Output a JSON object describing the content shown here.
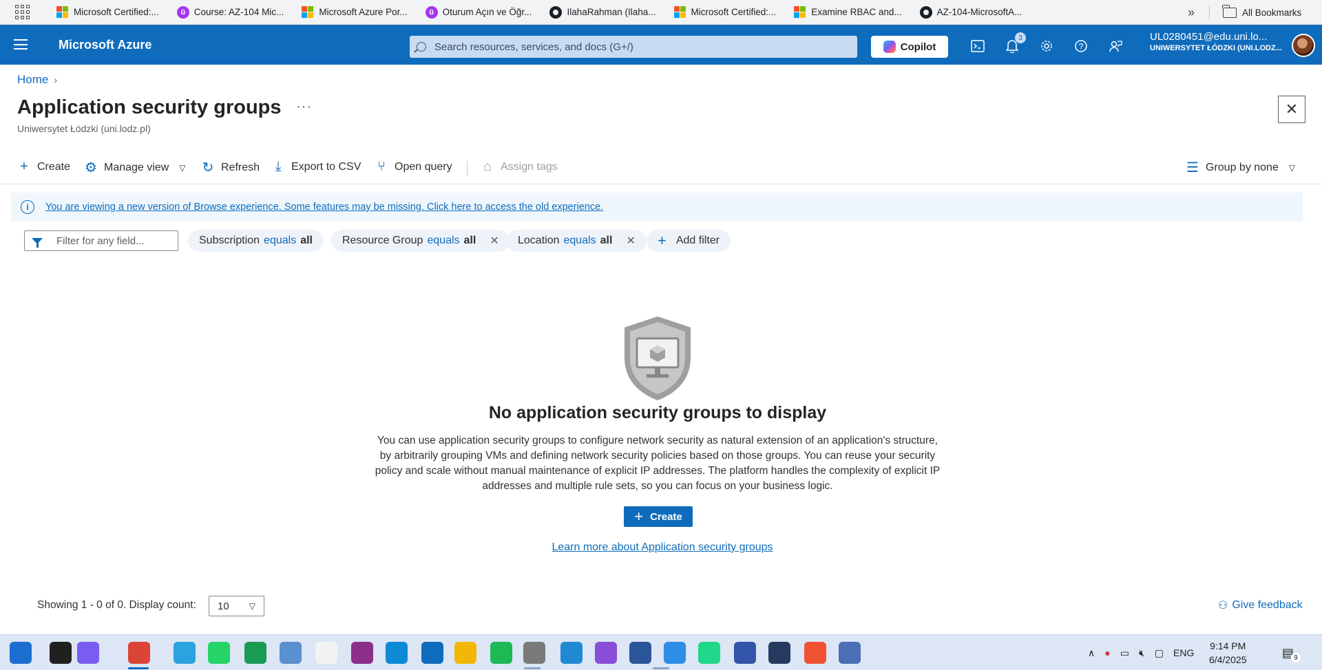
{
  "bookmarks": {
    "items": [
      {
        "label": "Microsoft Certified:...",
        "icon": "microsoft-logo"
      },
      {
        "label": "Course: AZ-104 Mic...",
        "icon": "udemy-logo"
      },
      {
        "label": "Microsoft Azure Por...",
        "icon": "microsoft-logo"
      },
      {
        "label": "Oturum Açın ve Öğr...",
        "icon": "udemy-logo"
      },
      {
        "label": "IlahaRahman (Ilaha...",
        "icon": "github-logo"
      },
      {
        "label": "Microsoft Certified:...",
        "icon": "microsoft-logo"
      },
      {
        "label": "Examine RBAC and...",
        "icon": "microsoft-logo"
      },
      {
        "label": "AZ-104-MicrosoftA...",
        "icon": "github-logo"
      }
    ],
    "udemy_letter": "ū",
    "more": "»",
    "all_bookmarks": "All Bookmarks"
  },
  "topnav": {
    "brand": "Microsoft Azure",
    "search_placeholder": "Search resources, services, and docs (G+/)",
    "copilot_label": "Copilot",
    "notifications_count": "3",
    "user_email": "UL0280451@edu.uni.lo...",
    "user_org": "UNIWERSYTET ŁÓDZKI (UNI.LODZ..."
  },
  "breadcrumb": {
    "home": "Home"
  },
  "page": {
    "title": "Application security groups",
    "subtitle": "Uniwersytet Łódzki (uni.lodz.pl)",
    "more": "···"
  },
  "commands": {
    "create": "Create",
    "manage_view": "Manage view",
    "refresh": "Refresh",
    "export_csv": "Export to CSV",
    "open_query": "Open query",
    "assign_tags": "Assign tags",
    "group_by": "Group by none"
  },
  "banner": {
    "text": "You are viewing a new version of Browse experience. Some features may be missing. Click here to access the old experience."
  },
  "filters": {
    "placeholder": "Filter for any field...",
    "pills": [
      {
        "field": "Subscription",
        "op": "equals",
        "value": "all",
        "removable": false
      },
      {
        "field": "Resource Group",
        "op": "equals",
        "value": "all",
        "removable": true
      },
      {
        "field": "Location",
        "op": "equals",
        "value": "all",
        "removable": true
      }
    ],
    "add_filter": "Add filter"
  },
  "empty_state": {
    "title": "No application security groups to display",
    "description": "You can use application security groups to configure network security as natural extension of an application's structure, by arbitrarily grouping VMs and defining network security policies based on those groups. You can reuse your security policy and scale without manual maintenance of explicit IP addresses. The platform handles the complexity of explicit IP addresses and multiple rule sets, so you can focus on your business logic.",
    "create_label": "Create",
    "learn_more": "Learn more about Application security groups"
  },
  "footer": {
    "showing": "Showing 1 - 0 of 0. Display count:",
    "display_count": "10",
    "feedback": "Give feedback"
  },
  "taskbar": {
    "language": "ENG",
    "time": "9:14 PM",
    "date": "6/4/2025",
    "notification_count": "9",
    "apps": [
      {
        "name": "start",
        "color": "#1c6fd1"
      },
      {
        "name": "search",
        "color": "#202020"
      },
      {
        "name": "copilot",
        "color": "#7b5cf0"
      },
      {
        "name": "chrome",
        "color": "#db4437"
      },
      {
        "name": "telegram",
        "color": "#2aa3df"
      },
      {
        "name": "whatsapp",
        "color": "#25d366"
      },
      {
        "name": "clion",
        "color": "#1a9b54"
      },
      {
        "name": "contacts",
        "color": "#5a8fd0"
      },
      {
        "name": "notepad",
        "color": "#f2f2f2"
      },
      {
        "name": "winrar",
        "color": "#8b2f8b"
      },
      {
        "name": "edge",
        "color": "#0c8ad6"
      },
      {
        "name": "outlook",
        "color": "#0f6cbd"
      },
      {
        "name": "file-explorer",
        "color": "#f2b705"
      },
      {
        "name": "spotify",
        "color": "#1db954"
      },
      {
        "name": "remote-tool",
        "color": "#7a7a7a"
      },
      {
        "name": "vscode",
        "color": "#1f8ad2"
      },
      {
        "name": "github-desktop",
        "color": "#8a4fd8"
      },
      {
        "name": "word",
        "color": "#2b579a"
      },
      {
        "name": "onedrive",
        "color": "#2e8ee6"
      },
      {
        "name": "pycharm",
        "color": "#21d789"
      },
      {
        "name": "app-m",
        "color": "#3355aa"
      },
      {
        "name": "powershell",
        "color": "#243a5e"
      },
      {
        "name": "git-tool",
        "color": "#f05133"
      },
      {
        "name": "network-tool",
        "color": "#4a6fb5"
      }
    ]
  }
}
